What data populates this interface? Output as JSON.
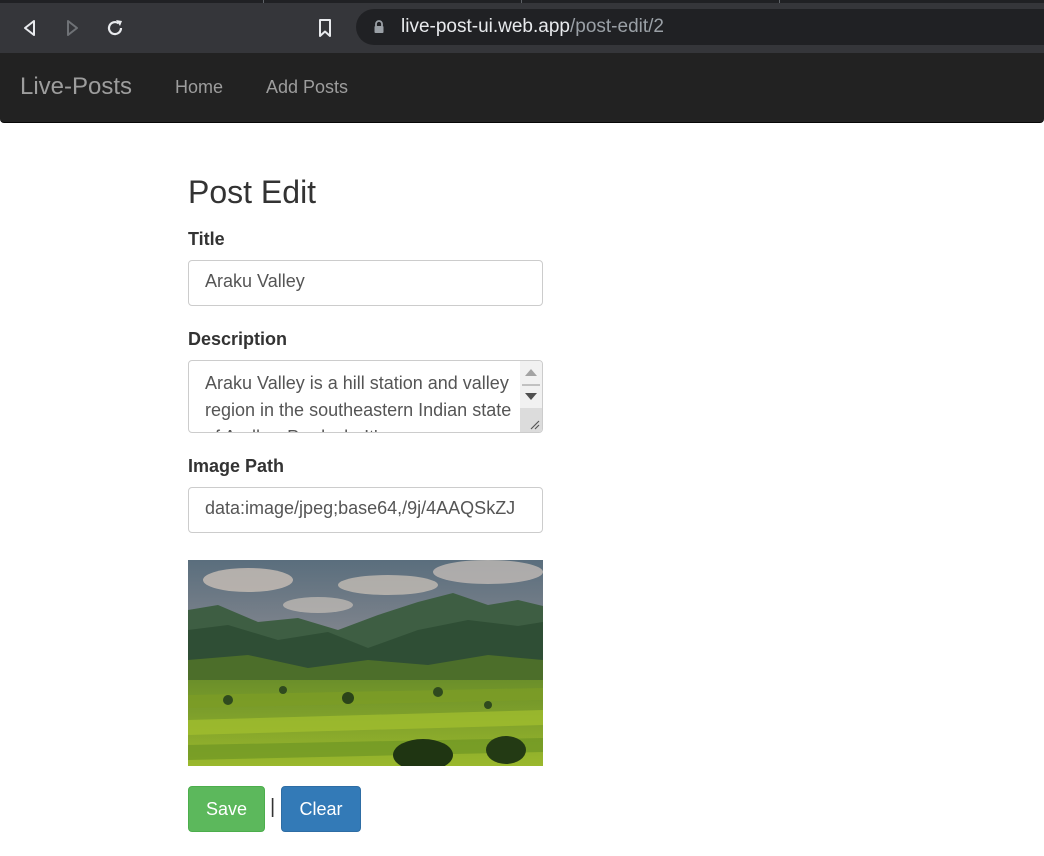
{
  "browser": {
    "url_host": "live-post-ui.web.app",
    "url_path": "/post-edit/2",
    "icons": [
      "back-icon",
      "forward-icon",
      "reload-icon",
      "bookmark-icon",
      "lock-icon"
    ]
  },
  "navbar": {
    "brand": "Live-Posts",
    "links": [
      "Home",
      "Add Posts"
    ]
  },
  "form": {
    "heading": "Post Edit",
    "title_label": "Title",
    "title_value": "Araku Valley",
    "description_label": "Description",
    "description_value": "Araku Valley is a hill station and valley region in the southeastern Indian state of Andhra Pradesh. It's",
    "image_path_label": "Image Path",
    "image_path_value": "data:image/jpeg;base64,/9j/4AAQSkZJ",
    "save_label": "Save",
    "separator": "|",
    "clear_label": "Clear"
  },
  "colors": {
    "navbar_bg": "#222222",
    "save_green": "#5cb85c",
    "clear_blue": "#337ab7"
  }
}
